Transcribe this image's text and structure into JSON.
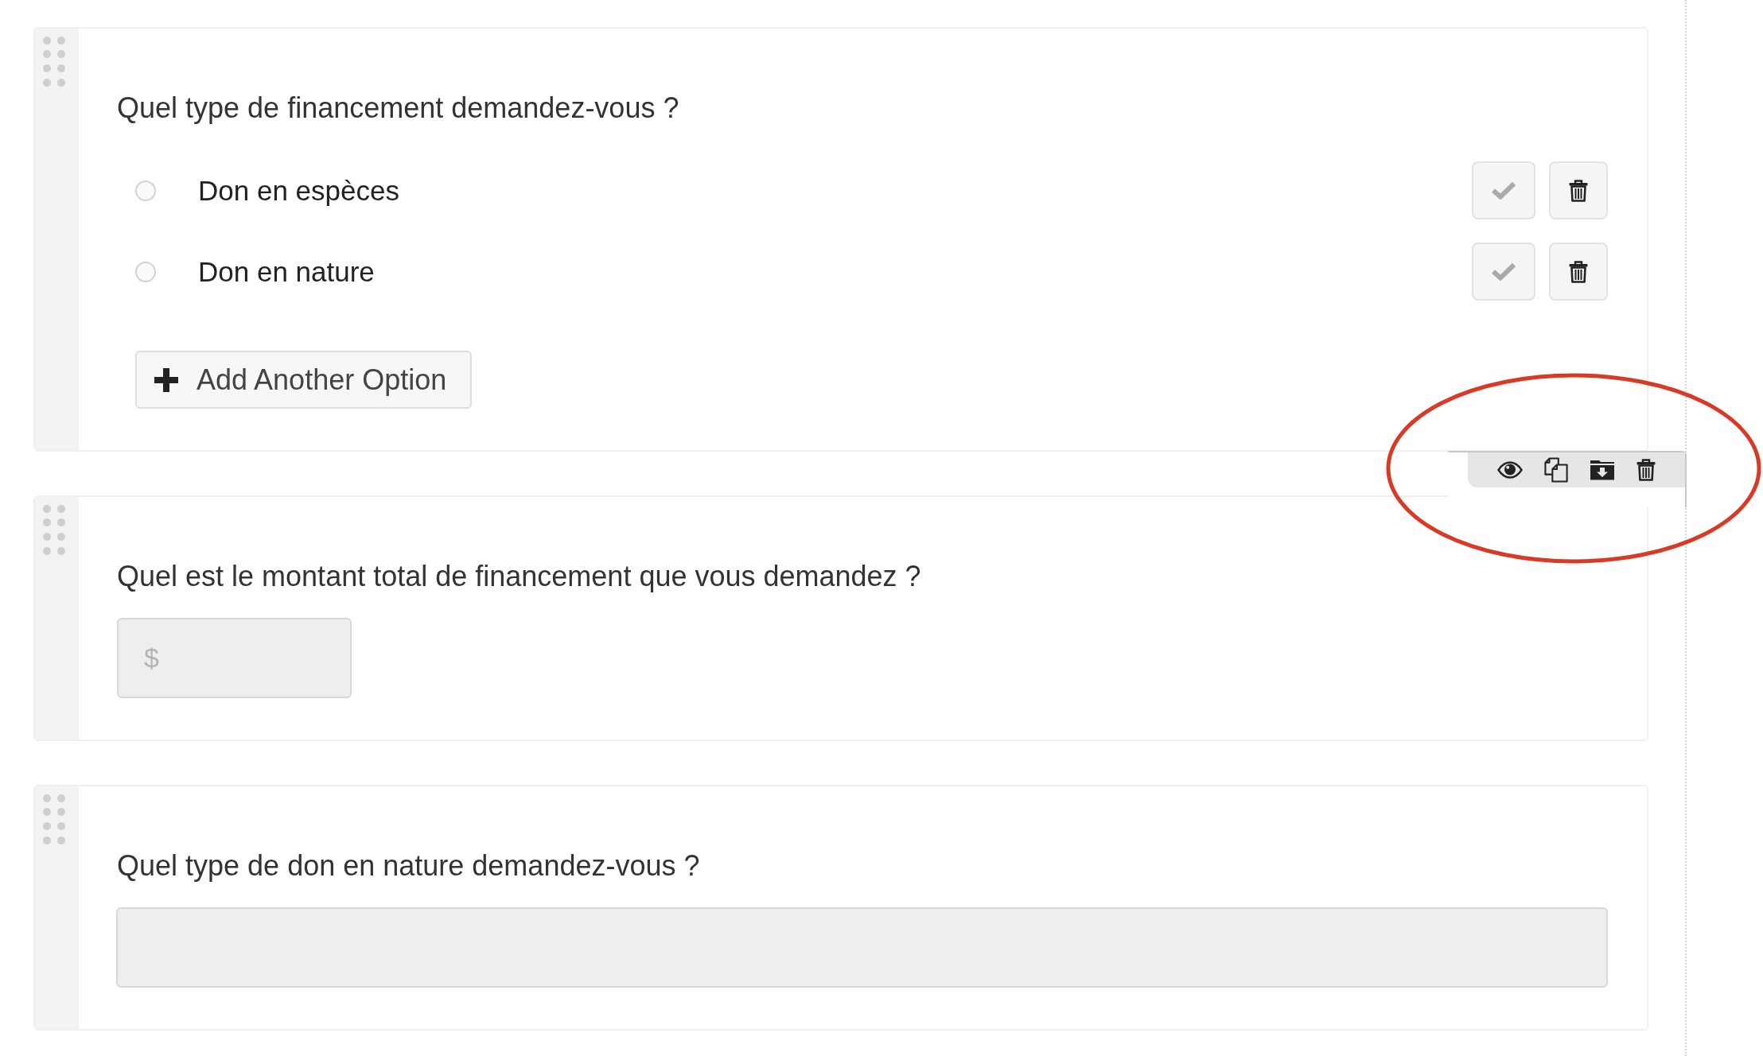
{
  "questions": [
    {
      "kind": "choice",
      "title": "Quel type de financement demandez-vous ?",
      "options": [
        {
          "label": "Don en espèces",
          "selected": false,
          "default": false
        },
        {
          "label": "Don en nature",
          "selected": false,
          "default": false
        }
      ],
      "add_option": "Add Another Option"
    },
    {
      "kind": "amount",
      "title": "Quel est le montant total de financement que vous demandez ?",
      "placeholder": "$"
    },
    {
      "kind": "text",
      "title": "Quel type de don en nature demandez-vous ?"
    }
  ]
}
